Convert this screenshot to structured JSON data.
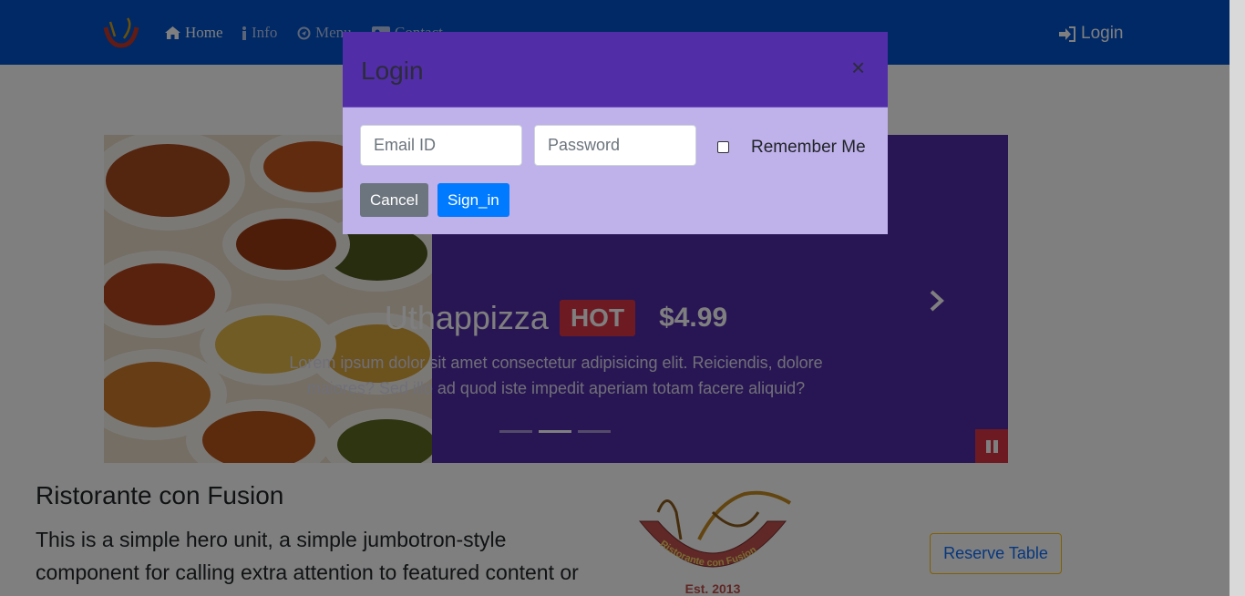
{
  "navbar": {
    "items": [
      {
        "label": "Home",
        "icon": "home-icon"
      },
      {
        "label": "Info",
        "icon": "info-icon"
      },
      {
        "label": "Menu",
        "icon": "list-icon"
      },
      {
        "label": "Contact",
        "icon": "address-card-icon"
      }
    ],
    "login_label": "Login"
  },
  "carousel": {
    "title": "Uthappizza",
    "badge": "HOT",
    "price": "$4.99",
    "description": "Lorem ipsum dolor sit amet consectetur adipisicing elit. Reiciendis, dolore maiores? Sed illo ad quod iste impedit aperiam totam facere aliquid?",
    "slides": 3,
    "active_slide": 2
  },
  "hero": {
    "title": "Ristorante con Fusion",
    "text": "This is a simple hero unit, a simple jumbotron-style component for calling extra attention to featured content or information."
  },
  "logo": {
    "text": "Ristorante con Fusion",
    "est": "Est. 2013"
  },
  "reserve_label": "Reserve Table",
  "modal": {
    "title": "Login",
    "close": "×",
    "email_placeholder": "Email ID",
    "password_placeholder": "Password",
    "remember_label": "Remember Me",
    "cancel_label": "Cancel",
    "signin_label": "Sign_in"
  },
  "colors": {
    "navbar": "#0052cc",
    "primary_purple": "#512da8",
    "modal_body": "#bfb1ea",
    "danger": "#dc3545",
    "secondary": "#6c757d",
    "primary_blue": "#007bff"
  }
}
